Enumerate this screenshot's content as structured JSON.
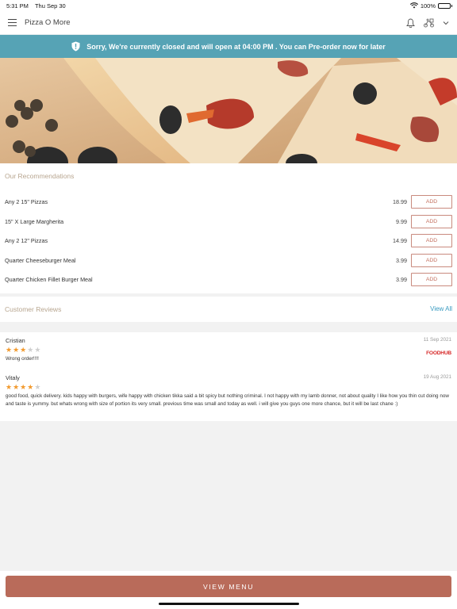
{
  "status_bar": {
    "time": "5:31 PM",
    "date": "Thu Sep 30",
    "battery": "100%"
  },
  "navbar": {
    "title": "Pizza O More",
    "icons": [
      "menu-icon",
      "bell-icon",
      "delivery-icon",
      "chevron-down-icon"
    ]
  },
  "banner": {
    "icon": "shield-alert-icon",
    "text": "Sorry, We're currently closed and will open at 04:00 PM . You can Pre-order now for later",
    "color": "#56a3b5"
  },
  "recommendations": {
    "title": "Our Recommendations",
    "items": [
      {
        "name": "Any 2 15\" Pizzas",
        "price": "18.99",
        "button": "ADD"
      },
      {
        "name": "15\" X Large Margherita",
        "price": "9.99",
        "button": "ADD"
      },
      {
        "name": "Any 2 12\" Pizzas",
        "price": "14.99",
        "button": "ADD"
      },
      {
        "name": "Quarter Cheeseburger Meal",
        "price": "3.99",
        "button": "ADD"
      },
      {
        "name": "Quarter Chicken Fillet Burger Meal",
        "price": "3.99",
        "button": "ADD"
      }
    ]
  },
  "reviews": {
    "title": "Customer Reviews",
    "view_all": "View All",
    "items": [
      {
        "name": "Cristian",
        "rating": 3,
        "max_rating": 5,
        "date": "11 Sep 2021",
        "source": "FOODHUB",
        "text": "Wrong order!!!!"
      },
      {
        "name": "Vitaly",
        "rating": 4,
        "max_rating": 5,
        "date": "19 Aug 2021",
        "source": "",
        "text": "good food, quick delivery. kids happy with burgers, wife happy with chicken tikka said a bit spicy but nothing criminal. I not happy with my lamb donner, not about quality I like how you thin cut doing now and taste is yummy. but whats wrong with size of portion its very small. previous time was small and today as well. i will give you guys one more chance, but it will be last chane :)"
      }
    ]
  },
  "footer": {
    "view_menu": "VIEW MENU",
    "accent": "#b96b5a"
  }
}
